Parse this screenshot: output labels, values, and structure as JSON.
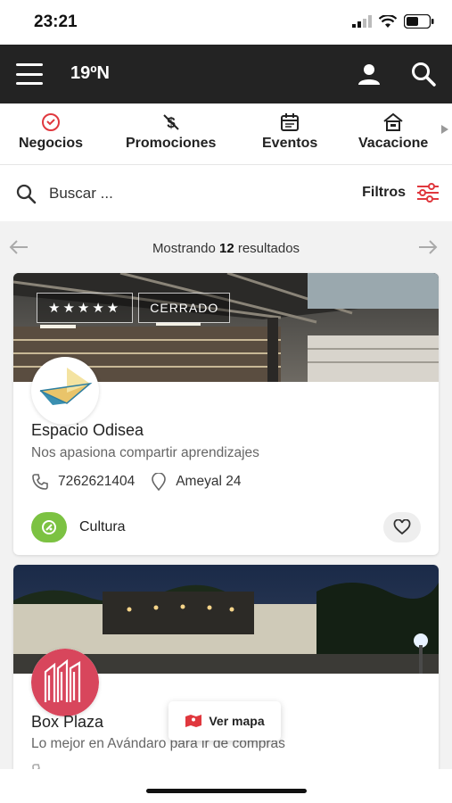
{
  "status_bar": {
    "time": "23:21"
  },
  "header": {
    "brand": "19ºN"
  },
  "categories": [
    {
      "label": "Negocios",
      "icon": "heart-badge-icon",
      "color": "#e0383e"
    },
    {
      "label": "Promociones",
      "icon": "dollar-off-icon"
    },
    {
      "label": "Eventos",
      "icon": "calendar-icon"
    },
    {
      "label": "Vacacione",
      "icon": "house-icon"
    }
  ],
  "search": {
    "placeholder": "Buscar ...",
    "filters_label": "Filtros"
  },
  "results": {
    "prefix": "Mostrando ",
    "count": "12",
    "suffix": " resultados"
  },
  "cards": [
    {
      "rating": "★★★★★",
      "status": "CERRADO",
      "title": "Espacio Odisea",
      "subtitle": "Nos apasiona compartir aprendizajes",
      "phone": "7262621404",
      "address": "Ameyal 24",
      "category": "Cultura",
      "category_color": "#7cc242"
    },
    {
      "title": "Box Plaza",
      "subtitle": "Lo mejor en Avándaro para ir de compras"
    }
  ],
  "map_button": {
    "label": "Ver mapa"
  },
  "colors": {
    "accent": "#e0383e",
    "header_bg": "#232323",
    "category_green": "#7cc242"
  }
}
